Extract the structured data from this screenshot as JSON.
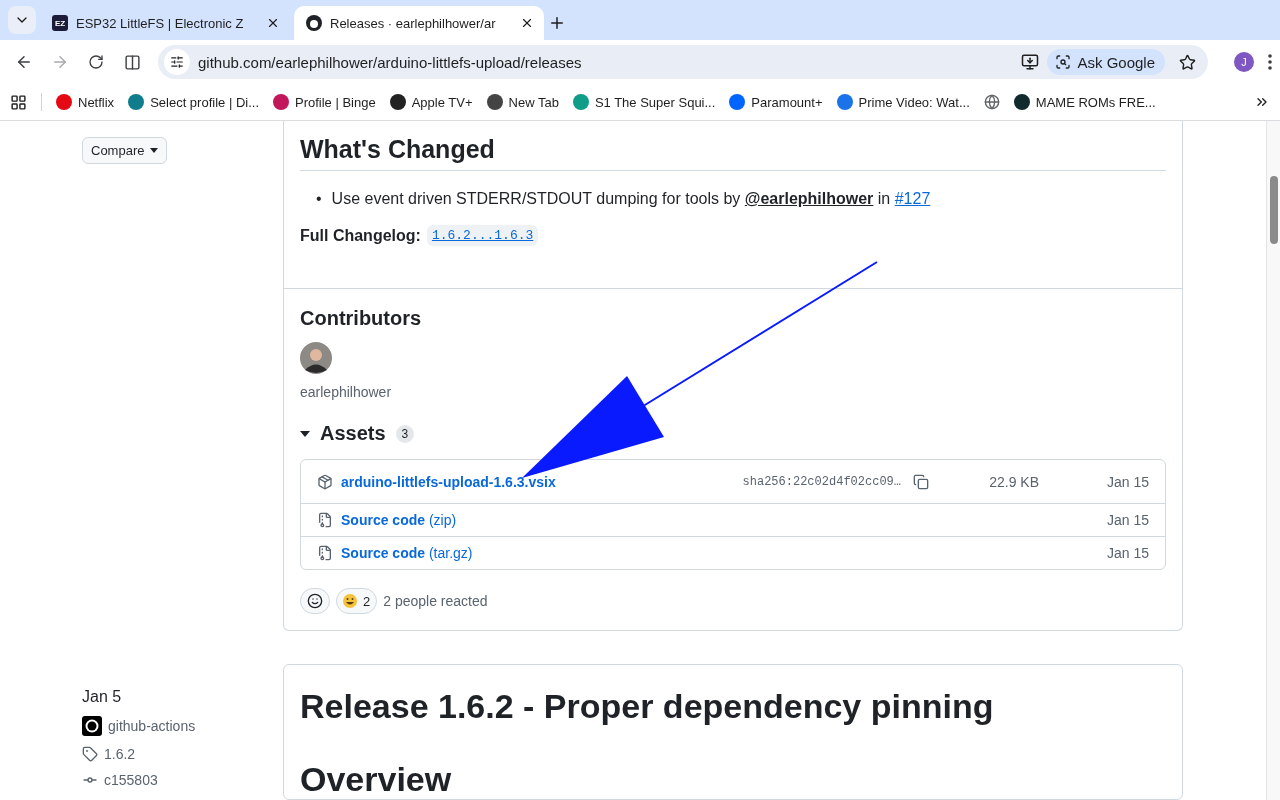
{
  "browser": {
    "tabs": [
      {
        "title": "ESP32 LittleFS | Electronic Z",
        "favicon": "EZ",
        "selected": false
      },
      {
        "title": "Releases · earlephilhower/ar",
        "selected": true
      }
    ],
    "forward_disabled": true,
    "address": "github.com/earlephilhower/arduino-littlefs-upload/releases",
    "ask_google": "Ask Google",
    "profile": "J",
    "bookmarks": [
      {
        "label": "Netflix",
        "color": "#e50914"
      },
      {
        "label": "Select profile | Di...",
        "color": "#0f7d8c"
      },
      {
        "label": "Profile | Binge",
        "color": "#c2185b"
      },
      {
        "label": "Apple TV+",
        "color": "#222222"
      },
      {
        "label": "New Tab",
        "color": "#444444"
      },
      {
        "label": "S1 The Super Squi...",
        "color": "#0f9d8a"
      },
      {
        "label": "Paramount+",
        "color": "#0064ff"
      },
      {
        "label": "Prime Video: Wat...",
        "color": "#1a73e8"
      },
      {
        "color": "#5f6368"
      },
      {
        "label": "MAME ROMs FRE...",
        "color": "#102a2e"
      }
    ]
  },
  "release_1": {
    "compare": "Compare",
    "changes_heading": "What's Changed",
    "changes": [
      {
        "marker": "•",
        "text": "Use event driven STDERR/STDOUT dumping for tools by",
        "author": "@earlephilhower",
        "joiner": "in",
        "pr": "#127"
      }
    ],
    "changelog_label": "Full Changelog:",
    "changelog_link": "1.6.2...1.6.3",
    "contributors_heading": "Contributors",
    "contributors": [
      "earlephilhower"
    ],
    "assets": {
      "heading": "Assets",
      "count": "3",
      "expanded": true,
      "rows": [
        {
          "kind": "package",
          "name": "arduino-littlefs-upload-1.6.3.vsix",
          "sha": "sha256:22c02d4f02cc09…",
          "size": "22.9 KB",
          "date": "Jan 15"
        },
        {
          "kind": "source",
          "name": "Source code",
          "suffix": "(zip)",
          "date": "Jan 15"
        },
        {
          "kind": "source",
          "name": "Source code",
          "suffix": "(tar.gz)",
          "date": "Jan 15"
        }
      ]
    },
    "reaction_count": "2",
    "reacted": "2 people reacted"
  },
  "release_2": {
    "date": "Jan 5",
    "author": "github-actions",
    "tag": "1.6.2",
    "commit": "c155803",
    "title": "Release 1.6.2 - Proper dependency pinning",
    "heading": "Overview"
  }
}
